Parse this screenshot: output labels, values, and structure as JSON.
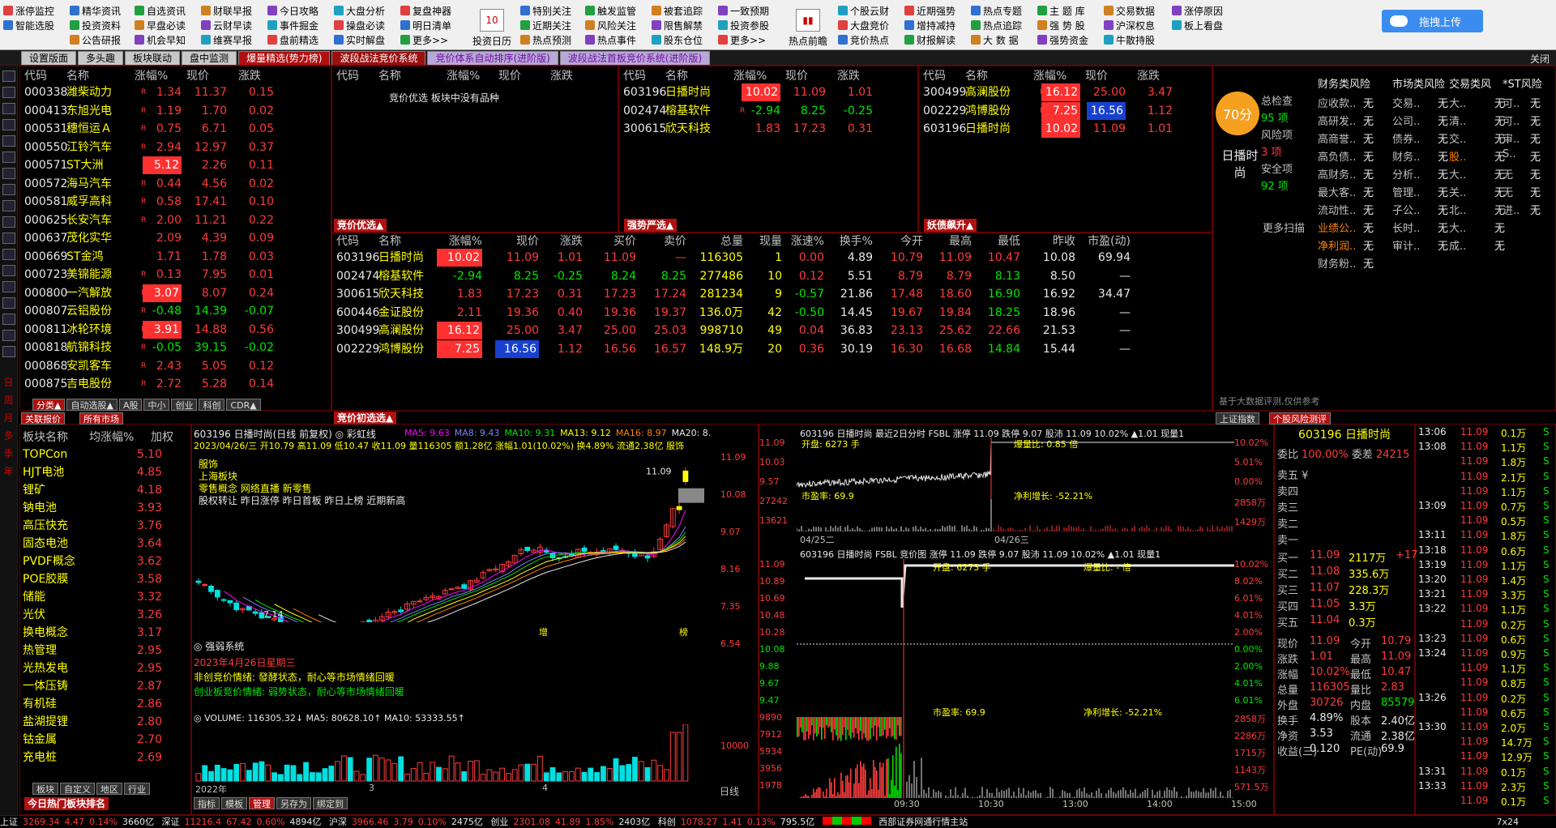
{
  "toolbar": {
    "col1": [
      "涨停监控",
      "智能选股"
    ],
    "col2": [
      "精华资讯",
      "投资资料",
      "公告研报"
    ],
    "col3": [
      "自选资讯",
      "早盘必读",
      "机会早知"
    ],
    "col4": [
      "财联早报",
      "云财早读",
      "维赛早报"
    ],
    "col5": [
      "今日攻略",
      "事件掘金",
      "盘前精选"
    ],
    "col6": [
      "大盘分析",
      "操盘必读",
      "实时解盘"
    ],
    "col7": [
      "复盘神器",
      "明日清单",
      "更多>>"
    ],
    "big1": "投资日历",
    "big1_day": "10",
    "col8": [
      "特别关注",
      "近期关注",
      "热点预测"
    ],
    "col9": [
      "触发监管",
      "风险关注",
      "热点事件"
    ],
    "col10": [
      "被套追踪",
      "限售解禁",
      "股东仓位"
    ],
    "col11": [
      "一致预期",
      "投资参股",
      "更多>>"
    ],
    "big2": "热点前瞻",
    "col12": [
      "个股云财",
      "大盘竞价",
      "竞价热点"
    ],
    "col13": [
      "近期强势",
      "增持减持",
      "财报解读"
    ],
    "col14": [
      "热点专题",
      "热点追踪",
      "大 数 据"
    ],
    "col15": [
      "主 题 库",
      "强 势 股",
      "强势资金"
    ],
    "col16": [
      "交易数据",
      "沪深权息",
      "牛散持股"
    ],
    "col17": [
      "涨停原因",
      "板上看盘"
    ],
    "cloud": "拖拽上传"
  },
  "tabs": [
    "设置版面",
    "多头趣",
    "板块联动",
    "盘中监测",
    "爆量精选(势力榜)",
    "波段战法竞价系统",
    "竞价体系自动排序(进阶版)",
    "波段战法首板竞价系统(进阶版)"
  ],
  "close": "关闭",
  "leftbar": [
    "日",
    "周",
    "月",
    "多",
    "季",
    "年"
  ],
  "list_headers": {
    "code": "代码",
    "name": "名称",
    "pct": "涨幅%",
    "price": "现价",
    "chg": "涨跌"
  },
  "stock_list": [
    {
      "code": "000338",
      "name": "潍柴动力",
      "r": "R",
      "pct": "1.34",
      "price": "11.37",
      "chg": "0.15",
      "c": "red"
    },
    {
      "code": "000413",
      "name": "东旭光电",
      "r": "R",
      "pct": "1.19",
      "price": "1.70",
      "chg": "0.02",
      "c": "red"
    },
    {
      "code": "000531",
      "name": "穗恒运Ａ",
      "r": "R",
      "pct": "0.75",
      "price": "6.71",
      "chg": "0.05",
      "c": "red"
    },
    {
      "code": "000550",
      "name": "江铃汽车",
      "r": "R",
      "pct": "2.94",
      "price": "12.97",
      "chg": "0.37",
      "c": "red"
    },
    {
      "code": "000571",
      "name": "ST大洲",
      "r": "",
      "pct": "5.12",
      "price": "2.26",
      "chg": "0.11",
      "c": "red",
      "hl": true
    },
    {
      "code": "000572",
      "name": "海马汽车",
      "r": "R",
      "pct": "0.44",
      "price": "4.56",
      "chg": "0.02",
      "c": "red"
    },
    {
      "code": "000581",
      "name": "威孚高科",
      "r": "R",
      "pct": "0.58",
      "price": "17.41",
      "chg": "0.10",
      "c": "red"
    },
    {
      "code": "000625",
      "name": "长安汽车",
      "r": "R",
      "pct": "2.00",
      "price": "11.21",
      "chg": "0.22",
      "c": "red"
    },
    {
      "code": "000637",
      "name": "茂化实华",
      "r": "",
      "pct": "2.09",
      "price": "4.39",
      "chg": "0.09",
      "c": "red"
    },
    {
      "code": "000669",
      "name": "ST金鸿",
      "r": "",
      "pct": "1.71",
      "price": "1.78",
      "chg": "0.03",
      "c": "red"
    },
    {
      "code": "000723",
      "name": "美锦能源",
      "r": "R",
      "pct": "0.13",
      "price": "7.95",
      "chg": "0.01",
      "c": "red"
    },
    {
      "code": "000800",
      "name": "一汽解放",
      "r": "R",
      "pct": "3.07",
      "price": "8.07",
      "chg": "0.24",
      "c": "red",
      "hl": true
    },
    {
      "code": "000807",
      "name": "云铝股份",
      "r": "R",
      "pct": "-0.48",
      "price": "14.39",
      "chg": "-0.07",
      "c": "grn"
    },
    {
      "code": "000811",
      "name": "冰轮环境",
      "r": "R",
      "pct": "3.91",
      "price": "14.88",
      "chg": "0.56",
      "c": "red",
      "hl": true
    },
    {
      "code": "000818",
      "name": "航锦科技",
      "r": "R",
      "pct": "-0.05",
      "price": "39.15",
      "chg": "-0.02",
      "c": "grn"
    },
    {
      "code": "000868",
      "name": "安凯客车",
      "r": "R",
      "pct": "2.43",
      "price": "5.05",
      "chg": "0.12",
      "c": "red"
    },
    {
      "code": "000875",
      "name": "吉电股份",
      "r": "R",
      "pct": "2.72",
      "price": "5.28",
      "chg": "0.14",
      "c": "red"
    }
  ],
  "list_tabs": [
    "分类▲",
    "自动选股▲",
    "A股",
    "中小",
    "创业",
    "科创",
    "CDR▲"
  ],
  "auction_panel": {
    "title": "竞价优选▲",
    "note": "竞价优选 板块中没有品种"
  },
  "strong_panel": {
    "title": "强势严选▲",
    "rows": [
      {
        "code": "603196",
        "name": "日播时尚",
        "r": "",
        "pct": "10.02",
        "price": "11.09",
        "chg": "1.01",
        "c": "red",
        "hl": true
      },
      {
        "code": "002474",
        "name": "榕基软件",
        "r": "R",
        "pct": "-2.94",
        "price": "8.25",
        "chg": "-0.25",
        "c": "grn"
      },
      {
        "code": "300615",
        "name": "欣天科技",
        "r": "",
        "pct": "1.83",
        "price": "17.23",
        "chg": "0.31",
        "c": "red"
      }
    ]
  },
  "surge_panel": {
    "title": "妖债飙升▲",
    "rows": [
      {
        "code": "300499",
        "name": "高澜股份",
        "r": "R",
        "pct": "16.12",
        "price": "25.00",
        "chg": "3.47",
        "c": "red",
        "hl": true
      },
      {
        "code": "002229",
        "name": "鸿博股份",
        "r": "R",
        "pct": "7.25",
        "price": "16.56",
        "chg": "1.12",
        "c": "red",
        "hl": true,
        "pb": true
      },
      {
        "code": "603196",
        "name": "日播时尚",
        "r": "",
        "pct": "10.02",
        "price": "11.09",
        "chg": "1.01",
        "c": "red",
        "hl": true
      }
    ]
  },
  "primary_panel": {
    "title": "竞价初选选▲",
    "headers": [
      "代码",
      "名称",
      "涨幅%",
      "现价",
      "涨跌",
      "买价",
      "卖价",
      "总量",
      "现量",
      "涨速%",
      "换手%",
      "今开",
      "最高",
      "最低",
      "昨收",
      "市盈(动)"
    ],
    "rows": [
      [
        "603196",
        "日播时尚",
        "10.02",
        "11.09",
        "1.01",
        "11.09",
        "—",
        "116305",
        "1",
        "0.00",
        "4.89",
        "10.79",
        "11.09",
        "10.47",
        "10.08",
        "69.94"
      ],
      [
        "002474",
        "榕基软件",
        "-2.94",
        "8.25",
        "-0.25",
        "8.24",
        "8.25",
        "277486",
        "10",
        "0.12",
        "5.51",
        "8.79",
        "8.79",
        "8.13",
        "8.50",
        "—"
      ],
      [
        "300615",
        "欣天科技",
        "1.83",
        "17.23",
        "0.31",
        "17.23",
        "17.24",
        "281234",
        "9",
        "-0.57",
        "21.86",
        "17.48",
        "18.60",
        "16.90",
        "16.92",
        "34.47"
      ],
      [
        "600446",
        "金证股份",
        "2.11",
        "19.36",
        "0.40",
        "19.36",
        "19.37",
        "136.0万",
        "42",
        "-0.50",
        "14.45",
        "19.67",
        "19.84",
        "18.25",
        "18.96",
        "—"
      ],
      [
        "300499",
        "高澜股份",
        "16.12",
        "25.00",
        "3.47",
        "25.00",
        "25.03",
        "998710",
        "49",
        "0.04",
        "36.83",
        "23.13",
        "25.62",
        "22.66",
        "21.53",
        "—"
      ],
      [
        "002229",
        "鸿博股份",
        "7.25",
        "16.56",
        "1.12",
        "16.56",
        "16.57",
        "148.9万",
        "20",
        "0.36",
        "30.19",
        "16.30",
        "16.68",
        "14.84",
        "15.44",
        "—"
      ]
    ]
  },
  "risk": {
    "score": "70分",
    "name": "日播时尚",
    "total_label": "总检查",
    "total": "95 项",
    "risk_label": "风险项",
    "risk": "3 项",
    "safe_label": "安全项",
    "safe": "92 项",
    "more": "更多扫描",
    "headers": [
      "财务类风险",
      "市场类风险",
      "交易类风",
      "*ST风险"
    ],
    "col1": [
      "应收款..",
      "高研发..",
      "高商誉..",
      "高负债..",
      "高财务..",
      "最大客..",
      "流动性..",
      "业绩公..",
      "净利润..",
      "财务粉.."
    ],
    "col2": [
      "交易..",
      "公司..",
      "债券..",
      "财务..",
      "分析..",
      "管理..",
      "子公..",
      "长时..",
      "审计.."
    ],
    "col3": [
      "大..",
      "清..",
      "交..",
      "股..",
      "大..",
      "关..",
      "北..",
      "大..",
      "成.."
    ],
    "col4": [
      "可..",
      "可..",
      "审..",
      "S..",
      "无",
      "无",
      "进.."
    ],
    "val": "无",
    "footer": "基于大数据评测,仅供参考",
    "tab1": "上证指数",
    "tab2": "个股风险测评"
  },
  "sectors": {
    "h1": "板块名称",
    "h2": "均涨幅%",
    "h3": "加权",
    "rows": [
      [
        "TOPCon",
        "5.10"
      ],
      [
        "HJT电池",
        "4.85"
      ],
      [
        "锂矿",
        "4.18"
      ],
      [
        "钠电池",
        "3.93"
      ],
      [
        "高压快充",
        "3.76"
      ],
      [
        "固态电池",
        "3.64"
      ],
      [
        "PVDF概念",
        "3.62"
      ],
      [
        "POE胶膜",
        "3.58"
      ],
      [
        "储能",
        "3.32"
      ],
      [
        "光伏",
        "3.26"
      ],
      [
        "换电概念",
        "3.17"
      ],
      [
        "热管理",
        "2.95"
      ],
      [
        "光热发电",
        "2.95"
      ],
      [
        "一体压铸",
        "2.87"
      ],
      [
        "有机硅",
        "2.86"
      ],
      [
        "盐湖提锂",
        "2.80"
      ],
      [
        "钴金属",
        "2.70"
      ],
      [
        "充电桩",
        "2.69"
      ]
    ],
    "tabs": [
      "板块",
      "自定义",
      "地区",
      "行业"
    ],
    "bottom": "今日热门板块排名",
    "tab_a": "关联报价",
    "tab_b": "所有市场"
  },
  "kchart": {
    "header": "603196 日播时尚(日线 前复权) ◎ 彩虹线",
    "ma": [
      "MA5: 9.63",
      "MA8: 9.43",
      "MA10: 9.31",
      "MA13: 9.12",
      "MA16: 8.97",
      "MA20: 8."
    ],
    "info": "2023/04/26/三 开10.79 高11.09 低10.47 收11.09 量116305 额1.28亿 涨幅1.01(10.02%) 换4.89% 流通2.38亿 服饰",
    "concept": [
      "服饰",
      "上海板块",
      "零售概念 网络直播 新零售",
      "股权转让 昨日涨停 昨日首板 昨日上榜 近期新高"
    ],
    "prices": [
      "11.09",
      "10.08",
      "9.07",
      "8.16",
      "7.35",
      "6.54"
    ],
    "high_label": "11.09",
    "low_label": "7.14",
    "strong_title": "◎ 强弱系统",
    "date": "2023年4月26日星期三",
    "s1": "非创竞价情绪: 發酵状态，耐心等市场情绪回暖",
    "s2": "创业板竞价情绪: 弱势状态，耐心等市场情绪回暖",
    "vol": "◎ VOLUME: 116305.32↓ MA5: 80628.10↑ MA10: 53333.55↑",
    "vol_scale": "10000",
    "xdate": [
      "2022年",
      "3",
      "4"
    ],
    "bottom_tabs": [
      "指标",
      "模板",
      "管理",
      "另存为",
      "绑定到"
    ],
    "period": "日线",
    "mark1": "增",
    "mark2": "榜"
  },
  "mini1": {
    "header": "603196 日播时尚  最近2日分时 FSBL 涨停 11.09 跌停 9.07 股沛 11.09 10.02% ▲1.01 现量1",
    "left": [
      "11.09",
      "10.03",
      "9.57",
      "27242",
      "13621"
    ],
    "right": [
      "10.02%",
      "5.01%",
      "0.00%",
      "2858万",
      "1429万"
    ],
    "open": "开盘: 6273 手",
    "ratio": "爆量比: 0.85 倍",
    "pe": "市盈率: 69.9",
    "np": "净利增长: -52.21%",
    "d1": "04/25二",
    "d2": "04/26三"
  },
  "mini2": {
    "header": "603196 日播时尚  FSBL 竞价图  涨停 11.09 跌停 9.07 股沛 11.09 10.02% ▲1.01 现量1",
    "left": [
      "11.09",
      "10.89",
      "10.69",
      "10.48",
      "10.28",
      "10.08",
      "9.88",
      "9.67",
      "9.47",
      "9890",
      "7912",
      "5934",
      "3956",
      "1978"
    ],
    "right": [
      "10.02%",
      "8.02%",
      "6.01%",
      "4.01%",
      "2.00%",
      "0.00%",
      "2.00%",
      "4.01%",
      "6.01%",
      "2858万",
      "2286万",
      "1715万",
      "1143万",
      "571.5万"
    ],
    "open": "开盘: 6273 手",
    "ratio": "爆量比: - 倍",
    "pe": "市盈率: 69.9",
    "np": "净利增长: -52.21%",
    "x": [
      "09:30",
      "10:30",
      "13:00",
      "14:00",
      "15:00"
    ]
  },
  "quote": {
    "title": "603196 日播时尚",
    "wb_label": "委比",
    "wb": "100.00%",
    "wc_label": "委差",
    "wc": "24215",
    "sells": [
      "卖五 ¥",
      "卖四",
      "卖三",
      "卖二",
      "卖一"
    ],
    "buys": [
      [
        "买一",
        "11.09",
        "2117万",
        "+17"
      ],
      [
        "买二",
        "11.08",
        "335.6万",
        ""
      ],
      [
        "买三",
        "11.07",
        "228.3万",
        ""
      ],
      [
        "买四",
        "11.05",
        "3.3万",
        ""
      ],
      [
        "买五",
        "11.04",
        "0.3万",
        ""
      ]
    ],
    "stats": [
      [
        "现价",
        "11.09",
        "今开",
        "10.79"
      ],
      [
        "涨跌",
        "1.01",
        "最高",
        "11.09"
      ],
      [
        "涨幅",
        "10.02%",
        "最低",
        "10.47"
      ],
      [
        "总量",
        "116305",
        "量比",
        "2.83"
      ],
      [
        "外盘",
        "30726",
        "内盘",
        "85579"
      ],
      [
        "换手",
        "4.89%",
        "股本",
        "2.40亿"
      ],
      [
        "净资",
        "3.53",
        "流通",
        "2.38亿"
      ],
      [
        "收益(三)",
        "0.120",
        "PE(动)",
        "69.9"
      ]
    ]
  },
  "ticks": [
    [
      "13:06",
      "11.09",
      "0.1万",
      "S"
    ],
    [
      "13:08",
      "11.09",
      "1.1万",
      "S"
    ],
    [
      "",
      "11.09",
      "1.8万",
      "S"
    ],
    [
      "",
      "11.09",
      "2.1万",
      "S"
    ],
    [
      "",
      "11.09",
      "1.1万",
      "S"
    ],
    [
      "13:09",
      "11.09",
      "0.7万",
      "S"
    ],
    [
      "",
      "11.09",
      "0.5万",
      "S"
    ],
    [
      "13:11",
      "11.09",
      "1.8万",
      "S"
    ],
    [
      "13:18",
      "11.09",
      "0.6万",
      "S"
    ],
    [
      "13:19",
      "11.09",
      "1.1万",
      "S"
    ],
    [
      "13:20",
      "11.09",
      "1.4万",
      "S"
    ],
    [
      "13:21",
      "11.09",
      "3.3万",
      "S"
    ],
    [
      "13:22",
      "11.09",
      "1.1万",
      "S"
    ],
    [
      "",
      "11.09",
      "0.2万",
      "S"
    ],
    [
      "13:23",
      "11.09",
      "0.6万",
      "S"
    ],
    [
      "13:24",
      "11.09",
      "0.9万",
      "S"
    ],
    [
      "",
      "11.09",
      "1.1万",
      "S"
    ],
    [
      "",
      "11.09",
      "0.8万",
      "S"
    ],
    [
      "13:26",
      "11.09",
      "0.2万",
      "S"
    ],
    [
      "",
      "11.09",
      "0.6万",
      "S"
    ],
    [
      "13:30",
      "11.09",
      "2.0万",
      "S"
    ],
    [
      "",
      "11.09",
      "14.7万",
      "S"
    ],
    [
      "",
      "11.09",
      "12.9万",
      "S"
    ],
    [
      "13:31",
      "11.09",
      "0.1万",
      "S"
    ],
    [
      "13:33",
      "11.09",
      "2.3万",
      "S"
    ],
    [
      "",
      "11.09",
      "0.1万",
      "S"
    ]
  ],
  "status": {
    "sh_label": "上证",
    "sh": "3269.34",
    "sh_c": "4.47",
    "sh_p": "0.14%",
    "sh_v": "3660亿",
    "sz_label": "深证",
    "sz": "11216.4",
    "sz_c": "67.42",
    "sz_p": "0.60%",
    "sz_v": "4894亿",
    "hs_label": "沪深",
    "hs": "3966.46",
    "hs_c": "3.79",
    "hs_p": "0.10%",
    "hs_v": "2475亿",
    "cy_label": "创业",
    "cy": "2301.08",
    "cy_c": "41.89",
    "cy_p": "1.85%",
    "cy_v": "2403亿",
    "kc_label": "科创",
    "kc": "1078.27",
    "kc_c": "1.41",
    "kc_p": "0.13%",
    "kc_v": "795.5亿",
    "broker": "西部证券网通行情主站",
    "clock": "7x24"
  }
}
